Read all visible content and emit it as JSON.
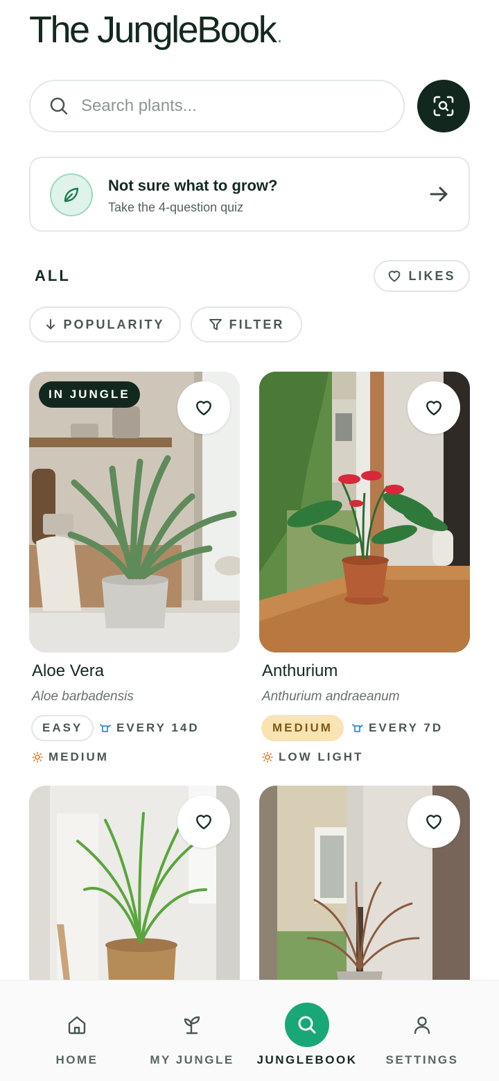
{
  "app": {
    "title": "The JungleBook",
    "title_dot": "."
  },
  "search": {
    "placeholder": "Search plants..."
  },
  "quiz": {
    "title": "Not sure what to grow?",
    "subtitle": "Take the 4-question quiz"
  },
  "section": {
    "heading": "ALL",
    "likes_label": "LIKES",
    "sort_label": "POPULARITY",
    "filter_label": "FILTER"
  },
  "plants": [
    {
      "name": "Aloe Vera",
      "latin": "Aloe barbadensis",
      "badge": "IN JUNGLE",
      "difficulty": "EASY",
      "watering": "EVERY 14D",
      "light": "MEDIUM"
    },
    {
      "name": "Anthurium",
      "latin": "Anthurium andraeanum",
      "difficulty": "MEDIUM",
      "watering": "EVERY 7D",
      "light": "LOW LIGHT"
    },
    {},
    {}
  ],
  "nav": {
    "items": [
      {
        "label": "HOME",
        "icon": "home-icon"
      },
      {
        "label": "MY JUNGLE",
        "icon": "sprout-icon"
      },
      {
        "label": "JUNGLEBOOK",
        "icon": "search-icon",
        "active": true
      },
      {
        "label": "SETTINGS",
        "icon": "user-icon"
      }
    ]
  },
  "colors": {
    "primary_dark": "#12281e",
    "accent_green": "#1aa777",
    "medium_badge": "#f9e3b3",
    "water_blue": "#2a8fd6",
    "sun_orange": "#e07a2e"
  }
}
